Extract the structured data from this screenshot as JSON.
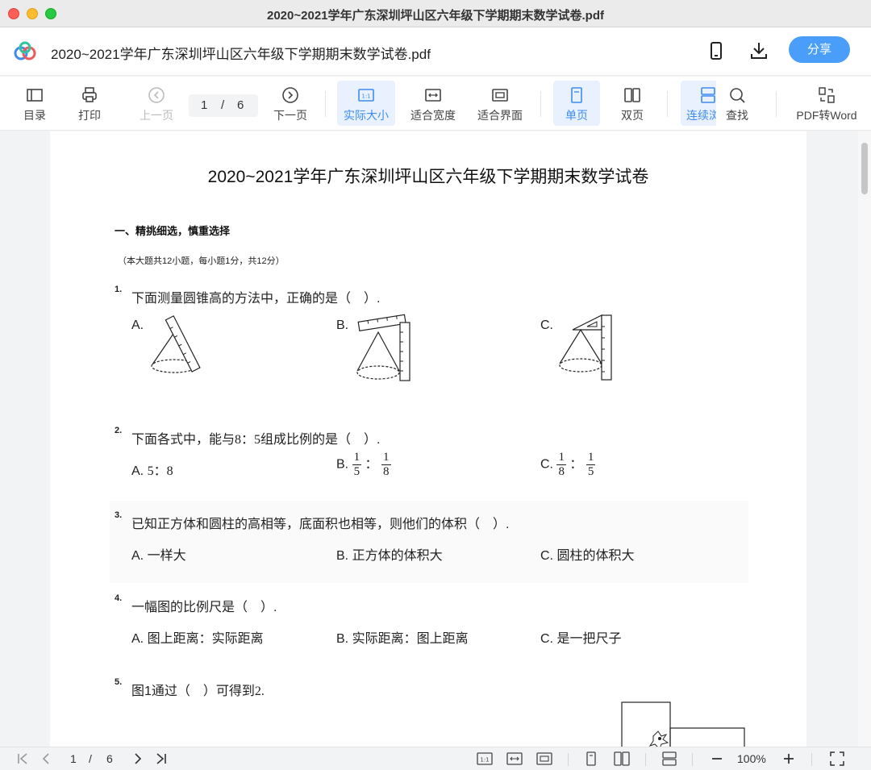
{
  "window": {
    "title": "2020~2021学年广东深圳坪山区六年级下学期期末数学试卷.pdf"
  },
  "header": {
    "file_name": "2020~2021学年广东深圳坪山区六年级下学期期末数学试卷.pdf",
    "share_label": "分享",
    "icons": [
      "phone-icon",
      "download-icon"
    ]
  },
  "toolbar": {
    "toc": "目录",
    "print": "打印",
    "prev": "上一页",
    "page_current": "1",
    "page_sep": "/",
    "page_total": "6",
    "next": "下一页",
    "actual_size": "实际大小",
    "fit_width": "适合宽度",
    "fit_page": "适合界面",
    "single": "单页",
    "double": "双页",
    "continuous": "连续浏",
    "find": "查找",
    "pdf_word": "PDF转Word",
    "accent_color": "#3f8cf0"
  },
  "document": {
    "title": "2020~2021学年广东深圳坪山区六年级下学期期末数学试卷",
    "section_title": "一、精挑细选，慎重选择",
    "section_note": "（本大题共12小题，每小题1分，共12分）",
    "questions": [
      {
        "num": "1.",
        "text": "下面测量圆锥高的方法中，正确的是（　）.",
        "options": [
          "A.",
          "B.",
          "C."
        ]
      },
      {
        "num": "2.",
        "text_a": "下面各式中，能与",
        "text_math": "8：5",
        "text_b": "组成比例的是（　）.",
        "option_a_label": "A.",
        "option_a_math": "5：8",
        "option_b_label": "B.",
        "option_b_num1": "1",
        "option_b_den1": "5",
        "option_b_num2": "1",
        "option_b_den2": "8",
        "option_c_label": "C.",
        "option_c_num1": "1",
        "option_c_den1": "8",
        "option_c_num2": "1",
        "option_c_den2": "5",
        "colon": "："
      },
      {
        "num": "3.",
        "text": "已知正方体和圆柱的高相等，底面积也相等，则他们的体积（　）.",
        "options": [
          "A. 一样大",
          "B. 正方体的体积大",
          "C. 圆柱的体积大"
        ]
      },
      {
        "num": "4.",
        "text": "一幅图的比例尺是（　）.",
        "options": [
          "A. 图上距离：实际距离",
          "B. 实际距离：图上距离",
          "C. 是一把尺子"
        ]
      },
      {
        "num": "5.",
        "text_a": "图1通过（　）可得到",
        "text_math": "2."
      }
    ]
  },
  "statusbar": {
    "page_current": "1",
    "page_sep": "/",
    "page_total": "6",
    "zoom": "100%"
  }
}
